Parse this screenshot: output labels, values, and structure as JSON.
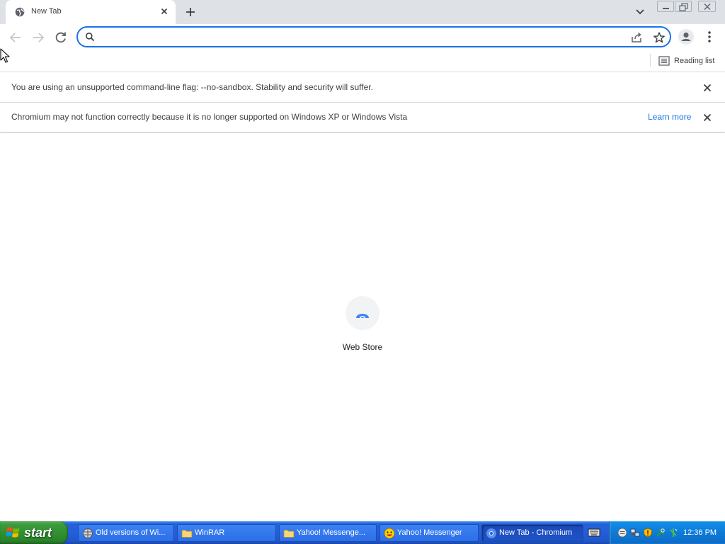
{
  "browser": {
    "tab": {
      "title": "New Tab"
    },
    "omnibox": {
      "value": "",
      "placeholder": ""
    },
    "bookmarks_bar": {
      "reading_list_label": "Reading list"
    },
    "infobars": [
      {
        "message": "You are using an unsupported command-line flag: --no-sandbox. Stability and security will suffer."
      },
      {
        "message": "Chromium may not function correctly because it is no longer supported on Windows XP or Windows Vista",
        "link": "Learn more"
      }
    ],
    "shortcuts": [
      {
        "label": "Web Store"
      }
    ]
  },
  "taskbar": {
    "start_label": "start",
    "tasks": [
      {
        "label": "Old versions of Wi...",
        "icon": "browser-icon",
        "active": false
      },
      {
        "label": "WinRAR",
        "icon": "folder-icon",
        "active": false
      },
      {
        "label": "Yahoo! Messenge...",
        "icon": "folder-icon",
        "active": false
      },
      {
        "label": "Yahoo! Messenger",
        "icon": "yahoo-messenger-icon",
        "active": false
      },
      {
        "label": "New Tab - Chromium",
        "icon": "chromium-icon",
        "active": true
      }
    ],
    "clock": "12:36 PM"
  },
  "colors": {
    "accent": "#1a73e8",
    "tabstrip": "#dee1e6",
    "taskbar": "#245edb",
    "start_button": "#319131",
    "tray": "#0e7ad7"
  }
}
